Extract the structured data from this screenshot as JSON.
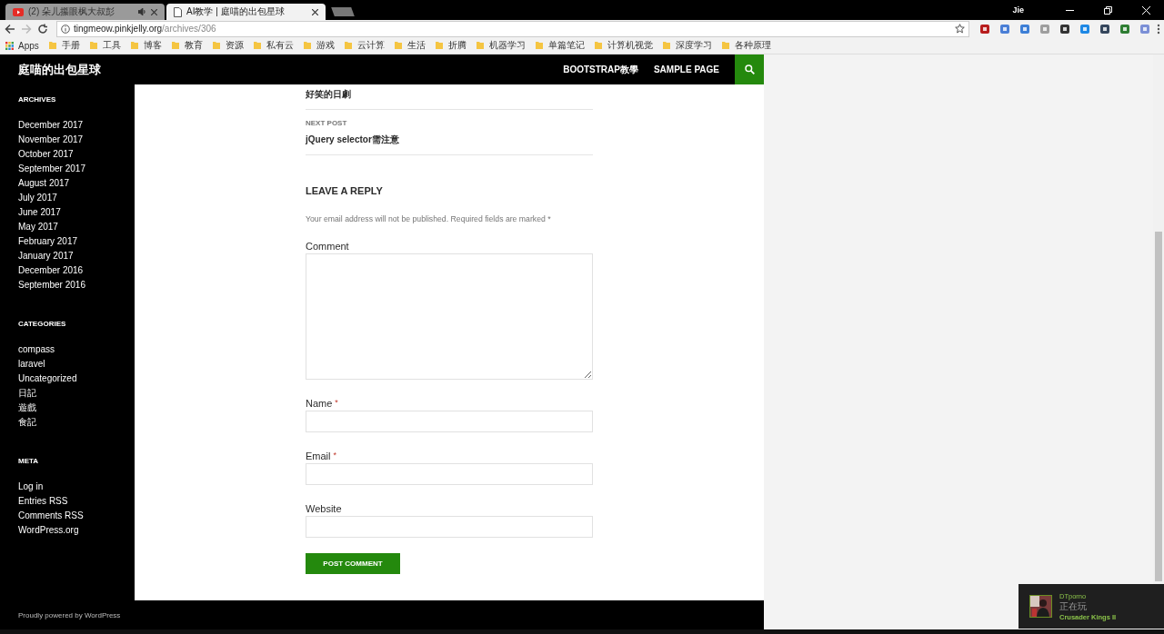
{
  "browser": {
    "tabs": [
      {
        "title": "(2) 朵儿攥眼枫大叔彭",
        "kind": "video",
        "audio": true,
        "selected": false
      },
      {
        "title": "AI教学 | 庭喵的出包星球",
        "kind": "page",
        "audio": false,
        "selected": true
      }
    ],
    "user": "Jie",
    "url_host": "tingmeow.pinkjelly.org",
    "url_path": "/archives/306",
    "bookmarks": [
      "Apps",
      "手册",
      "工具",
      "博客",
      "教育",
      "资源",
      "私有云",
      "游戏",
      "云计算",
      "生活",
      "折腾",
      "机器学习",
      "单篇笔记",
      "计算机视觉",
      "深度学习",
      "各种原理"
    ]
  },
  "site": {
    "title": "庭喵的出包星球",
    "nav": [
      "BOOTSTRAP教學",
      "SAMPLE PAGE"
    ]
  },
  "sidebar": [
    {
      "heading": "ARCHIVES",
      "items": [
        "December 2017",
        "November 2017",
        "October 2017",
        "September 2017",
        "August 2017",
        "July 2017",
        "June 2017",
        "May 2017",
        "February 2017",
        "January 2017",
        "December 2016",
        "September 2016"
      ]
    },
    {
      "heading": "CATEGORIES",
      "items": [
        "compass",
        "laravel",
        "Uncategorized",
        "日記",
        "遊戲",
        "食記"
      ]
    },
    {
      "heading": "META",
      "items": [
        "Log in",
        "Entries RSS",
        "Comments RSS",
        "WordPress.org"
      ]
    }
  ],
  "post_nav": {
    "previous_title": "好笑的日劇",
    "next_label": "NEXT POST",
    "next_title": "jQuery selector需注意"
  },
  "reply": {
    "heading": "LEAVE A REPLY",
    "note": "Your email address will not be published. Required fields are marked *",
    "fields": [
      {
        "label": "Comment",
        "kind": "textarea",
        "required": false
      },
      {
        "label": "Name",
        "kind": "input",
        "required": true
      },
      {
        "label": "Email",
        "kind": "input",
        "required": true
      },
      {
        "label": "Website",
        "kind": "input",
        "required": false
      }
    ],
    "required_mark": "*",
    "submit": "POST COMMENT"
  },
  "footer": "Proudly powered by WordPress",
  "notification": {
    "name": "DTporno",
    "status": "正在玩",
    "game": "Crusader Kings II"
  }
}
